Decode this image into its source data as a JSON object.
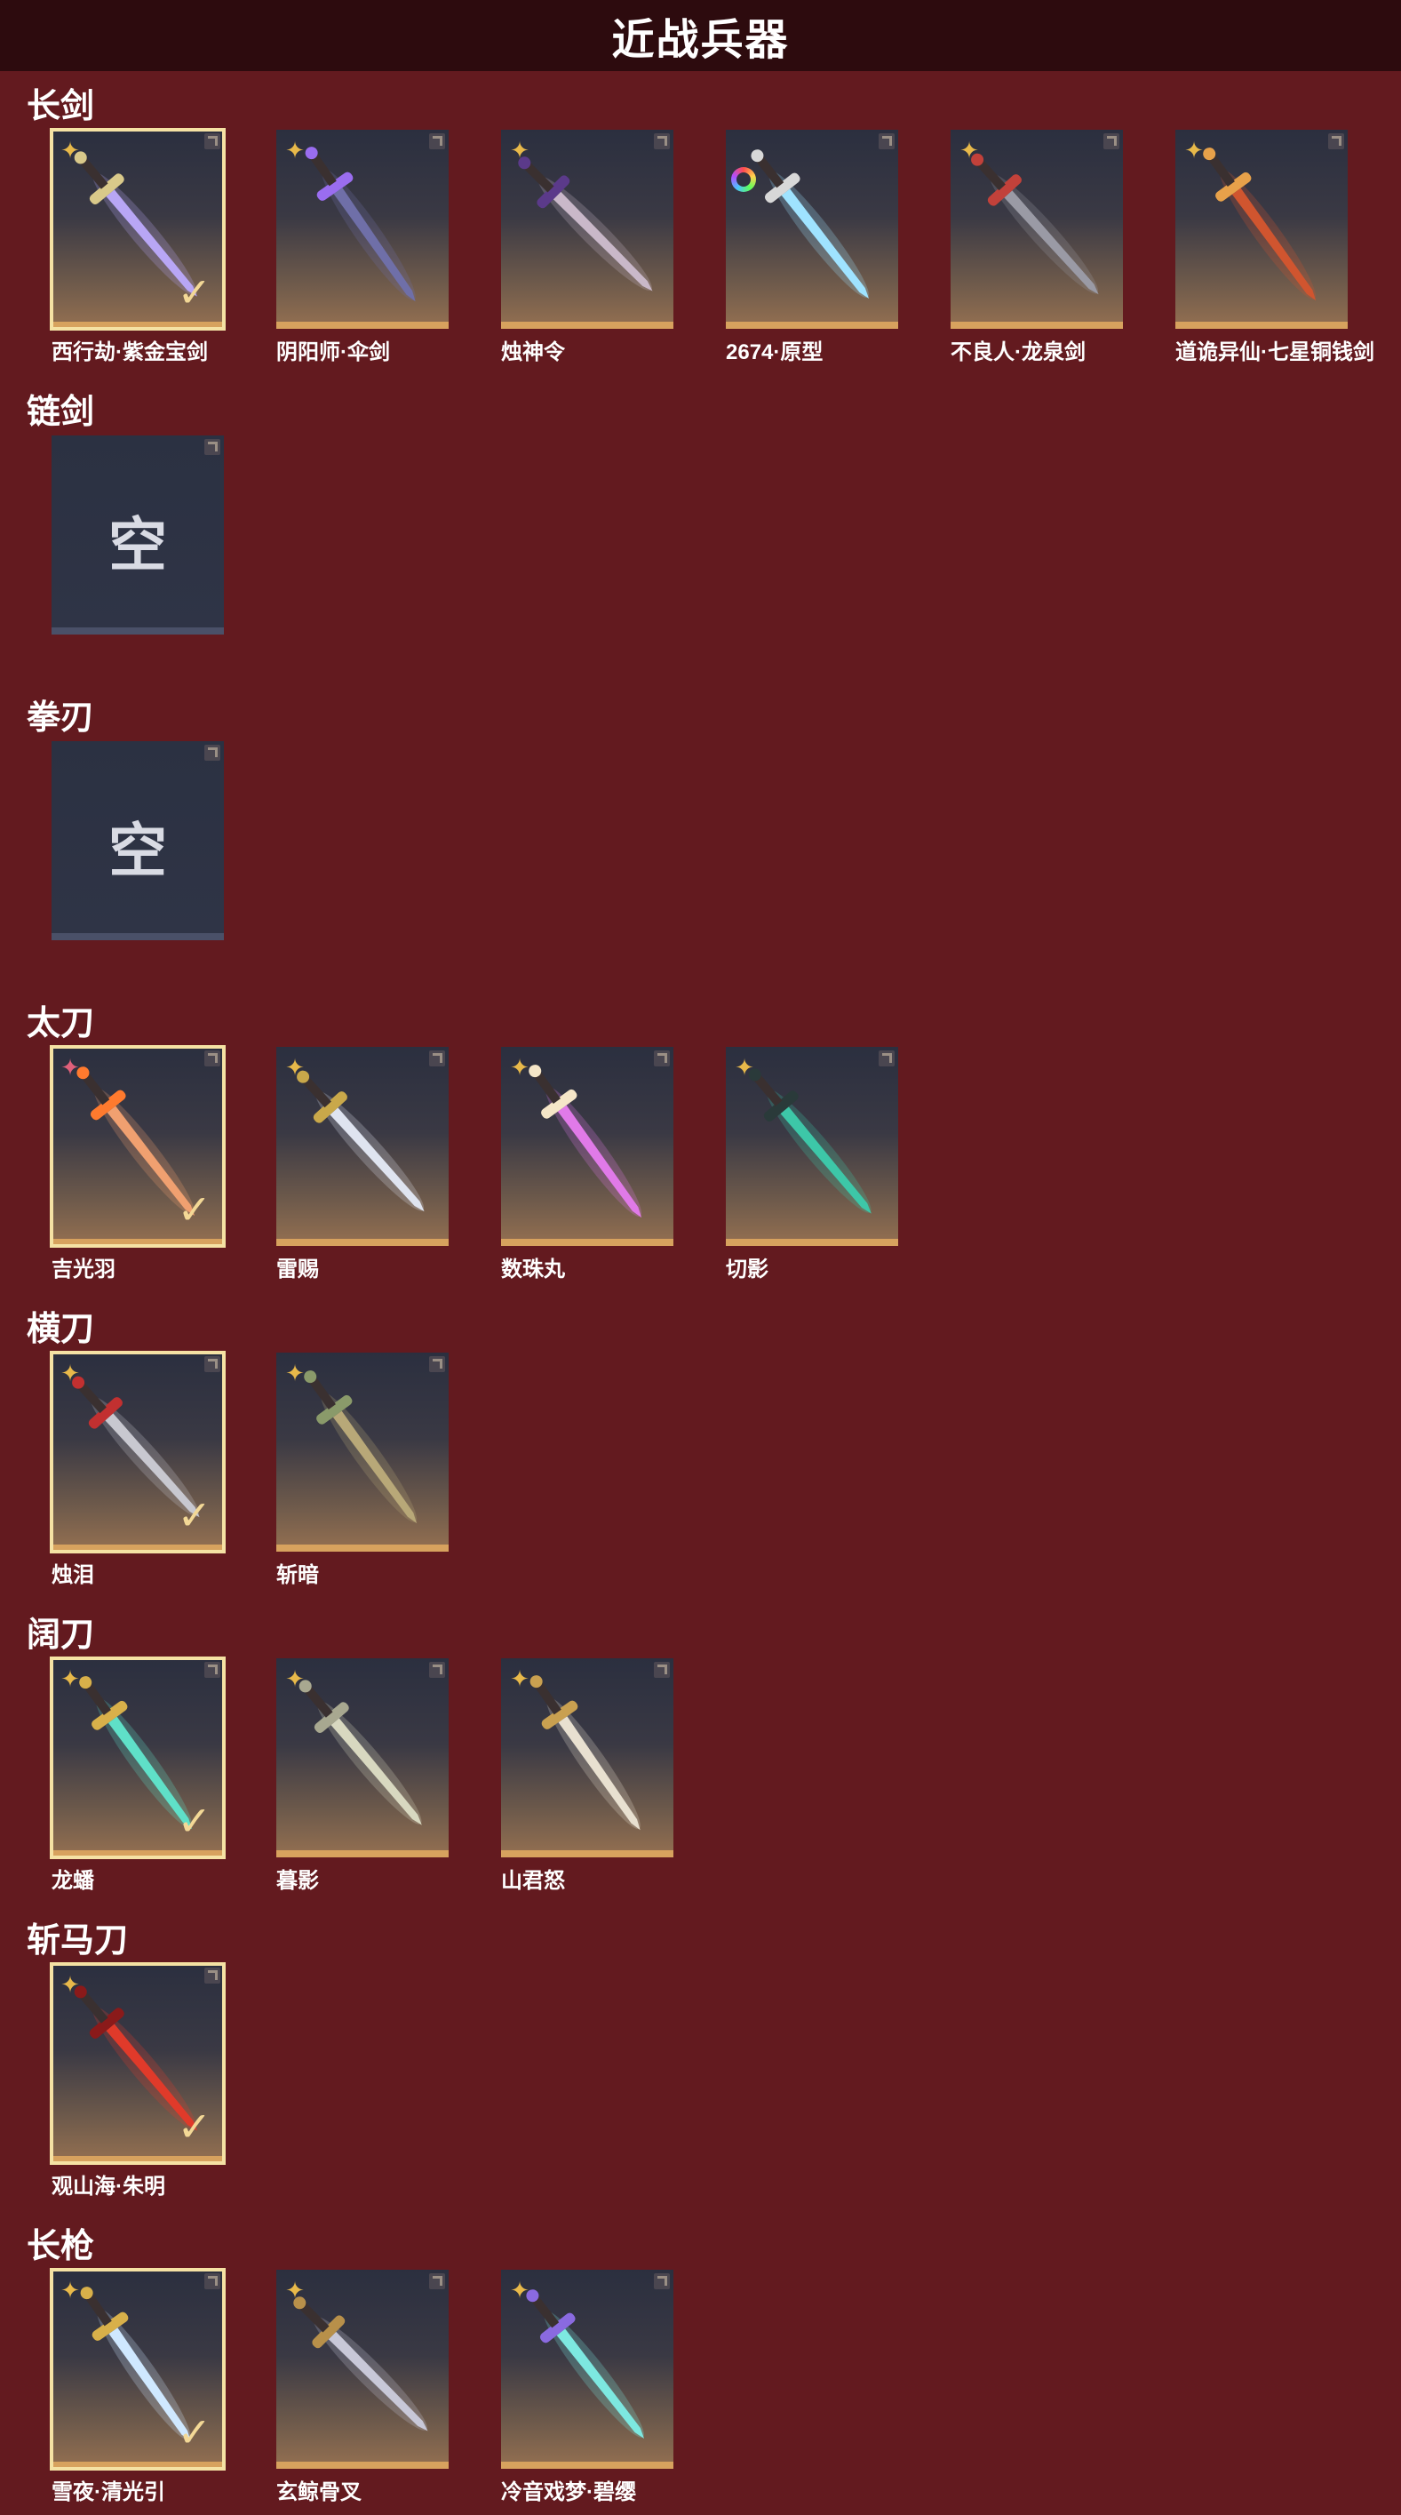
{
  "header": {
    "title": "近战兵器"
  },
  "colors": {
    "background": "#631a1f",
    "header_bg": "#2d0b0e",
    "card_border": "#d7a25e",
    "selected_outline": "#f5e2a4",
    "badge_gold": "#e8b94a",
    "badge_pink": "#e0607a"
  },
  "empty_label": "空",
  "check_glyph": "✓",
  "sections": [
    {
      "title": "长剑",
      "items": [
        {
          "name": "西行劫·紫金宝剑",
          "badge": "gold-star-icon",
          "selected": true,
          "blade": "#b8a6f5",
          "accent": "#d9c98a"
        },
        {
          "name": "阴阳师·伞剑",
          "badge": "gold-star-icon",
          "selected": false,
          "blade": "#6f6fa8",
          "accent": "#9a6df0"
        },
        {
          "name": "烛神令",
          "badge": "gold-star-icon",
          "selected": false,
          "blade": "#c9b8c9",
          "accent": "#5b3a8a"
        },
        {
          "name": "2674·原型",
          "badge": "rainbow-ring-icon",
          "selected": false,
          "blade": "#9fe3ff",
          "accent": "#d8d8d8"
        },
        {
          "name": "不良人·龙泉剑",
          "badge": "gold-star-icon",
          "selected": false,
          "blade": "#9a9aa5",
          "accent": "#c2413a"
        },
        {
          "name": "道诡异仙·七星铜钱剑",
          "badge": "gold-star-icon",
          "selected": false,
          "blade": "#d0552f",
          "accent": "#e7a14a"
        }
      ]
    },
    {
      "title": "链剑",
      "items": [
        {
          "empty": true
        }
      ]
    },
    {
      "title": "拳刃",
      "items": [
        {
          "empty": true
        }
      ]
    },
    {
      "title": "太刀",
      "items": [
        {
          "name": "吉光羽",
          "badge": "pink-star-icon",
          "selected": true,
          "blade": "#f0a070",
          "accent": "#ff7a2e"
        },
        {
          "name": "雷赐",
          "badge": "gold-star-icon",
          "selected": false,
          "blade": "#dfe4f0",
          "accent": "#c9a84a"
        },
        {
          "name": "数珠丸",
          "badge": "gold-star-icon",
          "selected": false,
          "blade": "#e07ae8",
          "accent": "#f5e6c8"
        },
        {
          "name": "切影",
          "badge": "gold-star-icon",
          "selected": false,
          "blade": "#3dc7a8",
          "accent": "#2a3a3a"
        }
      ]
    },
    {
      "title": "横刀",
      "items": [
        {
          "name": "烛泪",
          "badge": "gold-star-icon",
          "selected": true,
          "blade": "#c8c8d0",
          "accent": "#c23030"
        },
        {
          "name": "斩暗",
          "badge": "gold-star-icon",
          "selected": false,
          "blade": "#b8a878",
          "accent": "#8a9a6a"
        }
      ]
    },
    {
      "title": "阔刀",
      "items": [
        {
          "name": "龙蟠",
          "badge": "gold-star-icon",
          "selected": true,
          "blade": "#5fe0c8",
          "accent": "#d8b04a"
        },
        {
          "name": "暮影",
          "badge": "gold-star-icon",
          "selected": false,
          "blade": "#d8d8c0",
          "accent": "#a8a890"
        },
        {
          "name": "山君怒",
          "badge": "gold-star-icon",
          "selected": false,
          "blade": "#e8e0d0",
          "accent": "#c9a050"
        }
      ]
    },
    {
      "title": "斩马刀",
      "items": [
        {
          "name": "观山海·朱明",
          "badge": "gold-star-icon",
          "selected": true,
          "blade": "#e03a2a",
          "accent": "#8a1a1a"
        }
      ]
    },
    {
      "title": "长枪",
      "items": [
        {
          "name": "雪夜·清光引",
          "badge": "gold-star-icon",
          "selected": true,
          "blade": "#cfe8ff",
          "accent": "#d8b04a"
        },
        {
          "name": "玄鲸骨叉",
          "badge": "gold-star-icon",
          "selected": false,
          "blade": "#c8c8d8",
          "accent": "#b8904a"
        },
        {
          "name": "冷音戏梦·碧缨",
          "badge": "gold-star-icon",
          "selected": false,
          "blade": "#7de8e0",
          "accent": "#8a6ae0"
        }
      ]
    }
  ]
}
